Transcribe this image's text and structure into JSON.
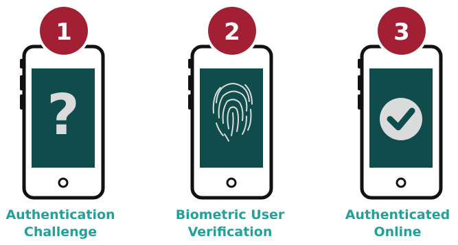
{
  "colors": {
    "badge": "#a31f34",
    "screen": "#0f4c4b",
    "caption": "#23a09a",
    "phone_outline": "#111111"
  },
  "steps": [
    {
      "number": "1",
      "icon": "question-mark-icon",
      "caption_line1": "Authentication",
      "caption_line2": "Challenge"
    },
    {
      "number": "2",
      "icon": "fingerprint-icon",
      "caption_line1": "Biometric User",
      "caption_line2": "Verification"
    },
    {
      "number": "3",
      "icon": "checkmark-circle-icon",
      "caption_line1": "Authenticated",
      "caption_line2": "Online"
    }
  ]
}
